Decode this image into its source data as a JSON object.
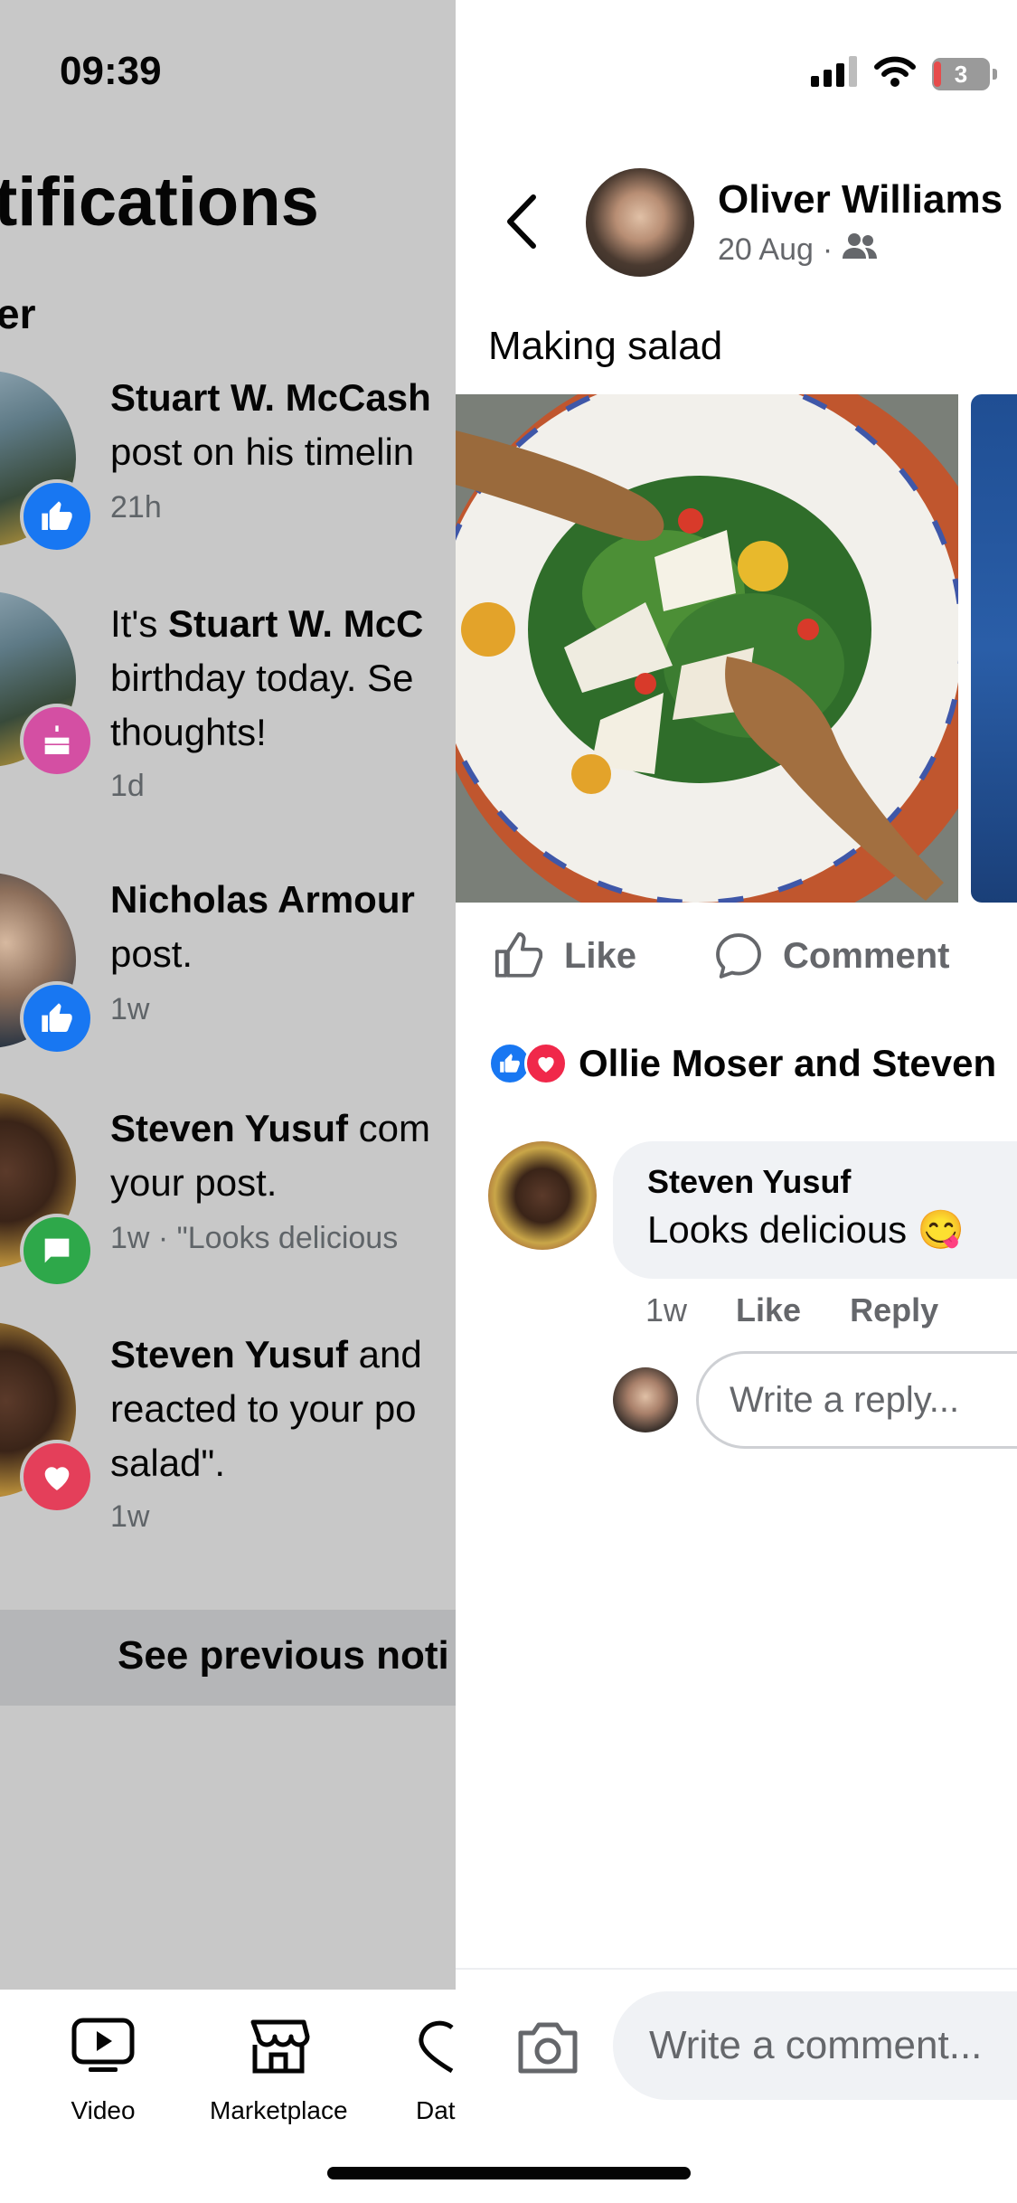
{
  "status_bar": {
    "time": "09:39",
    "battery": "3"
  },
  "notifications_panel": {
    "title": "tifications",
    "subheading": "er",
    "items": [
      {
        "bold": "Stuart W. McCash",
        "text_after": "",
        "line2": "post on his timelin",
        "line3": "",
        "time": "21h",
        "badge": "like"
      },
      {
        "bold": "Stuart W. McC",
        "text_before": "It's ",
        "line2": "birthday today. Se",
        "line3": "thoughts!",
        "time": "1d",
        "badge": "birthday"
      },
      {
        "bold": "Nicholas Armour",
        "text_after": "",
        "line2": "post.",
        "line3": "",
        "time": "1w",
        "badge": "like"
      },
      {
        "bold": "Steven Yusuf",
        "text_after": " com",
        "line2": "your post.",
        "line3": "",
        "time": "1w · \"Looks delicious",
        "badge": "comment"
      },
      {
        "bold": "Steven Yusuf",
        "text_after": " and",
        "line2": "reacted to your po",
        "line3": "salad\".",
        "time": "1w",
        "badge": "heart"
      }
    ],
    "see_previous": "See previous noti",
    "bottom_nav": [
      {
        "label": "Video",
        "icon": "video-icon"
      },
      {
        "label": "Marketplace",
        "icon": "marketplace-icon"
      },
      {
        "label": "Dat",
        "icon": "dating-icon"
      }
    ]
  },
  "post": {
    "author": "Oliver Williams",
    "date": "20 Aug",
    "audience_separator": "·",
    "audience_icon": "friends-icon",
    "text": "Making salad",
    "actions": {
      "like": "Like",
      "comment": "Comment"
    },
    "reactions_text": "Ollie Moser and Steven",
    "comment": {
      "author": "Steven Yusuf",
      "text": "Looks delicious 😋",
      "time": "1w",
      "like": "Like",
      "reply": "Reply"
    },
    "reply_placeholder": "Write a reply...",
    "comment_placeholder": "Write a comment..."
  },
  "colors": {
    "accent_blue": "#1877f2",
    "heart_red": "#f0284a",
    "comment_green": "#2ea84a",
    "birthday_pink": "#d44fa3",
    "dim_overlay": "#c8c8c8",
    "secondary_text": "#65676b"
  }
}
